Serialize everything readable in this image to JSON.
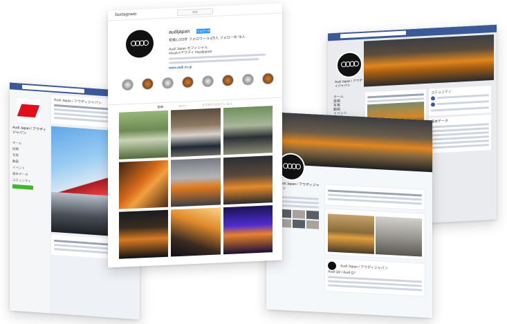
{
  "instagram": {
    "logo": "Instagram",
    "search_placeholder": "検索",
    "handle": "audijapan",
    "follow_label": "フォロー中",
    "stats": "投稿1,055件   フォロワー 9.4万人   フォロー中 78人",
    "bio_name": "Audi Japan オフィシャル",
    "bio_line1": "#Audi #アウディ #audijapan",
    "bio_line2": "www.audi.co.jp",
    "highlight_labels": [
      "",
      "",
      "",
      "",
      "",
      "",
      "",
      "",
      "",
      ""
    ],
    "tabs": [
      "投稿",
      "IGTV",
      "タグ付けされている人"
    ]
  },
  "facebook_left": {
    "page_name": "Audi Japan / アウディジャパン",
    "nav": [
      "ホーム",
      "投稿",
      "写真",
      "動画",
      "イベント",
      "基本データ",
      "コミュニティ"
    ],
    "post_header": "Audi Japan / アウディジャパン"
  },
  "twitter": {
    "name": "Audi Japan / アウディジャパン",
    "tweet_author": "Audi Japan / アウディジャパン",
    "tweet_text": "Audi Q8 / Audi Q7"
  },
  "facebook_right": {
    "page_name": "Audi Japan / アウディジャパン",
    "nav": [
      "ホーム",
      "投稿",
      "写真",
      "動画",
      "イベント"
    ],
    "community_title": "コミュニティ",
    "about_title": "基本データ"
  },
  "colors": {
    "facebook_blue": "#3b5998",
    "instagram_blue": "#3897f0",
    "audi_red": "#e20f1a"
  },
  "icons": [
    "audi-rings-icon",
    "search-icon"
  ]
}
